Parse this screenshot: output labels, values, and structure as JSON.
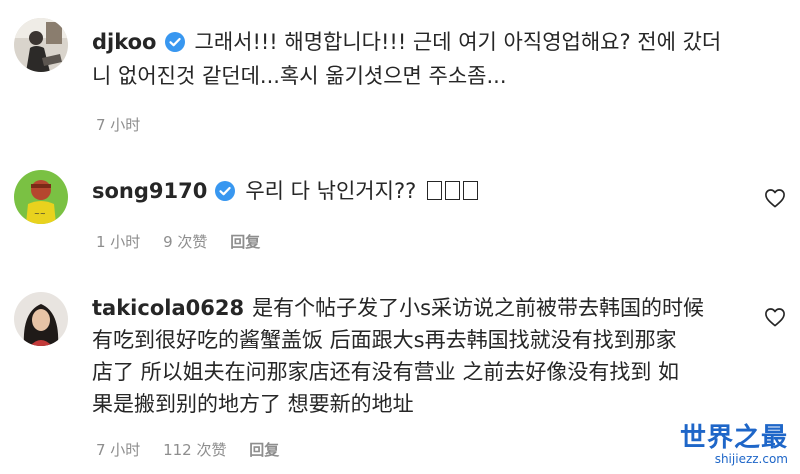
{
  "comments": [
    {
      "username": "djkoo",
      "text_line1": "그래서!!! 해명합니다!!! 근데 여기 아직영업해요? 전에 갔더",
      "text_line2": "니 없어진것 같던데...혹시 옮기셧으면 주소좀...",
      "time": "7 小时"
    },
    {
      "username": "song9170",
      "text_line1": "우리 다 낚인거지??",
      "time": "1 小时",
      "likes": "9 次赞",
      "reply": "回复"
    },
    {
      "username": "takicola0628",
      "text_line1": "是有个帖子发了小s采访说之前被带去韩国的时候",
      "text_line2": "有吃到很好吃的酱蟹盖饭 后面跟大s再去韩国找就没有找到那家",
      "text_line3": "店了 所以姐夫在问那家店还有没有营业 之前去好像没有找到 如",
      "text_line4": "果是搬到别的地方了 想要新的地址",
      "time": "7 小时",
      "likes": "112 次赞",
      "reply": "回复"
    }
  ],
  "watermark": {
    "title": "世界之最",
    "url": "shijiezz.com"
  },
  "colors": {
    "verified": "#3897f0",
    "meta": "#8e8e8e",
    "text": "#262626",
    "watermark": "#1e66c8"
  }
}
